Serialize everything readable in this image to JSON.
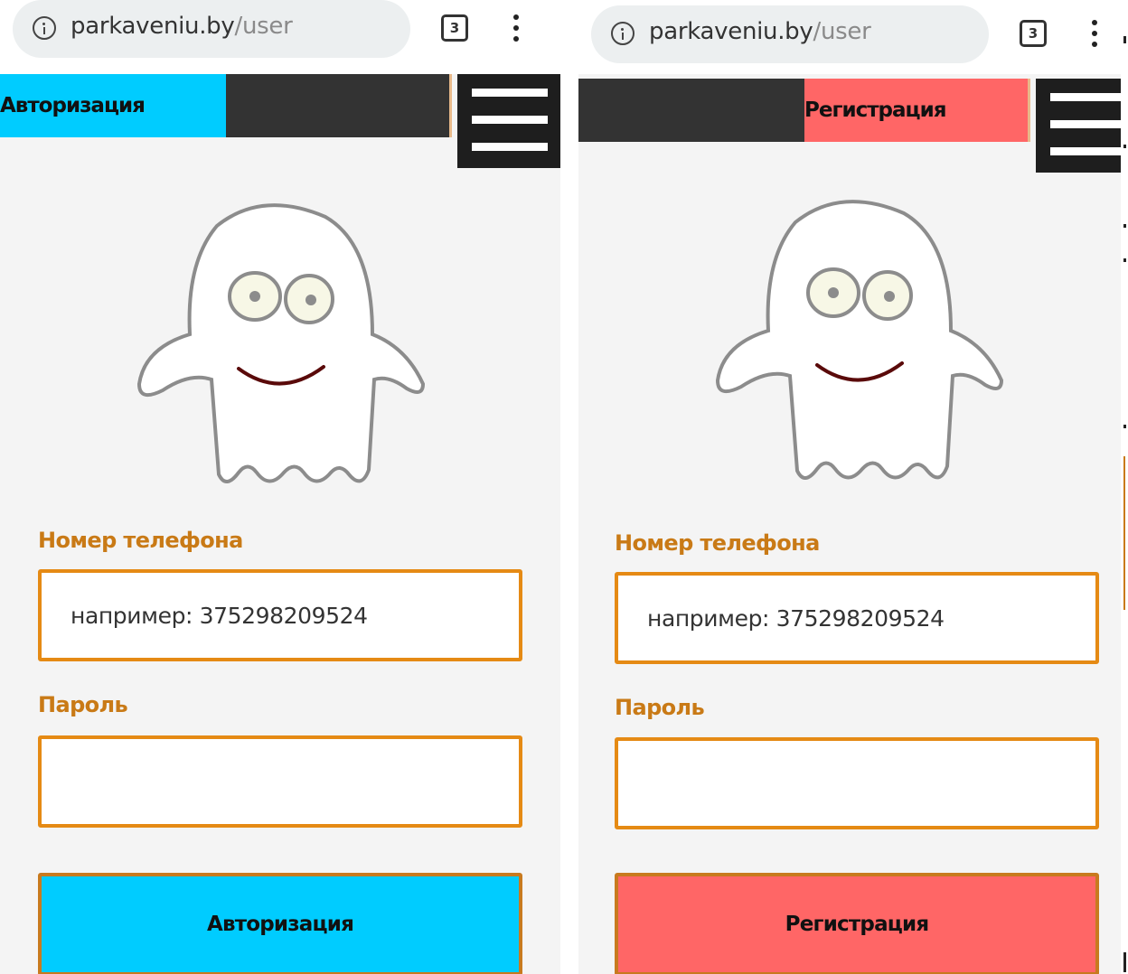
{
  "colors": {
    "login_accent": "#00ccff",
    "register_accent": "#ff6666",
    "dark_tab": "#333333",
    "menu_bg": "#1e1e1e",
    "label": "#c97a16",
    "input_border": "#e58a14",
    "page_bg": "#f4f4f4"
  },
  "left": {
    "browser": {
      "url_domain": "parkaveniu.by",
      "url_path": "/user",
      "tab_count": "3"
    },
    "tabs": {
      "login_label": "Авторизация",
      "register_label": ""
    },
    "form": {
      "phone_label": "Номер телефона",
      "phone_placeholder": "например: 375298209524",
      "password_label": "Пароль",
      "submit_label": "Авторизация"
    }
  },
  "right": {
    "browser": {
      "url_domain": "parkaveniu.by",
      "url_path": "/user",
      "tab_count": "3"
    },
    "tabs": {
      "login_label": "",
      "register_label": "Регистрация"
    },
    "form": {
      "phone_label": "Номер телефона",
      "phone_placeholder": "например: 375298209524",
      "password_label": "Пароль",
      "submit_label": "Регистрация"
    }
  },
  "icons": {
    "info": "info-icon",
    "tabs": "tabs-count-icon",
    "overflow": "kebab-menu-icon",
    "menu": "hamburger-icon",
    "mascot": "ghost-mascot"
  }
}
